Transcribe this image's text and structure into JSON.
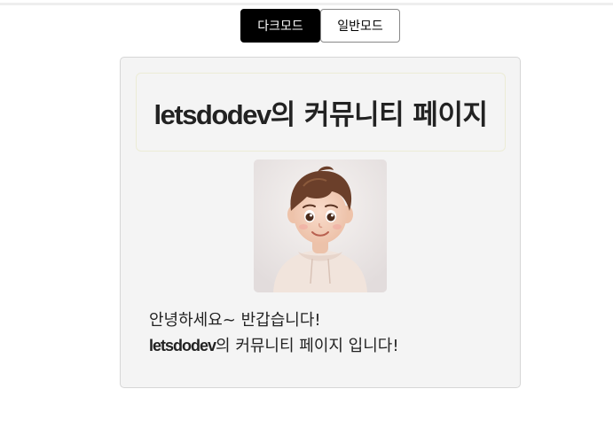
{
  "mode_toggle": {
    "dark_label": "다크모드",
    "light_label": "일반모드"
  },
  "profile": {
    "brand": "letsdodev",
    "title_suffix": "의 커뮤니티 페이지",
    "greeting": "안녕하세요~ 반갑습니다!",
    "intro_suffix": "의 커뮤니티 페이지 입니다!"
  },
  "colors": {
    "dark_button_bg": "#000000",
    "card_bg": "#f4f4f4",
    "text": "#222222"
  }
}
